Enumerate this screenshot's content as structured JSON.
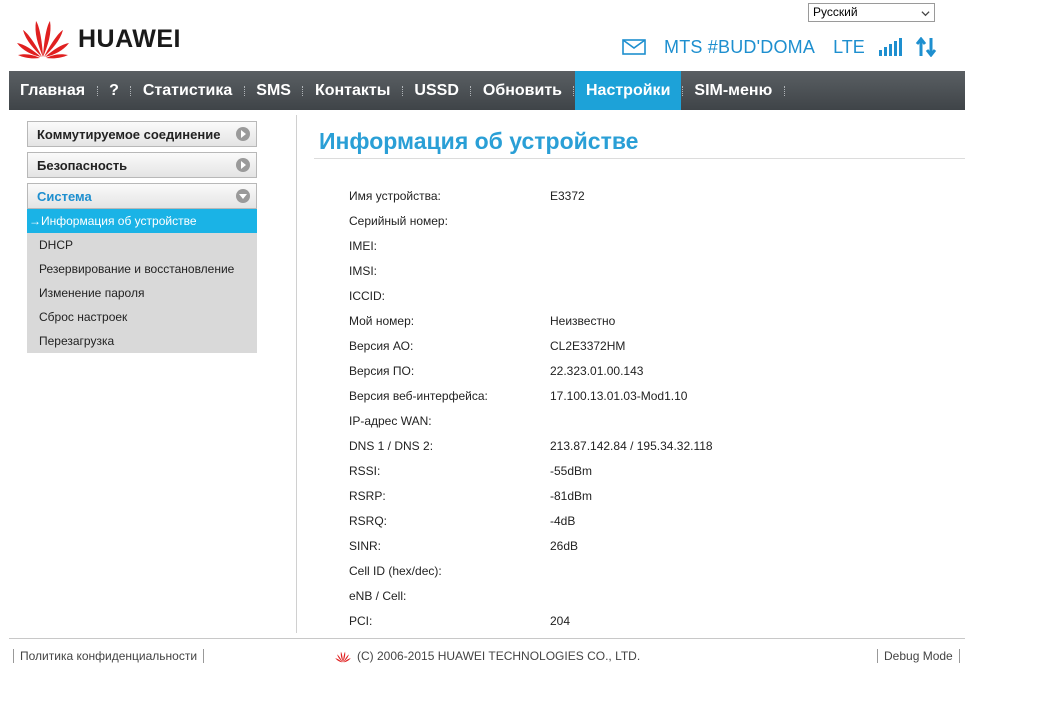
{
  "language": {
    "selected": "Русский"
  },
  "brand": {
    "name": "HUAWEI",
    "color": "#e02020"
  },
  "status": {
    "operator": "MTS #BUD'DOMA",
    "network": "LTE",
    "icons": [
      "mail-icon",
      "signal-icon",
      "data-arrows-icon"
    ],
    "accent_color": "#1e8fcf"
  },
  "nav": {
    "items": [
      "Главная",
      "?",
      "Статистика",
      "SMS",
      "Контакты",
      "USSD",
      "Обновить",
      "Настройки",
      "SIM-меню"
    ],
    "active": "Настройки",
    "active_color": "#1da2d8"
  },
  "sidebar": {
    "groups": [
      {
        "label": "Коммутируемое соединение"
      },
      {
        "label": "Безопасность"
      },
      {
        "label": "Система"
      }
    ],
    "system_items": [
      "→Информация об устройстве",
      "DHCP",
      "Резервирование и восстановление",
      "Изменение пароля",
      "Сброс настроек",
      "Перезагрузка"
    ]
  },
  "page": {
    "title": "Информация об устройстве",
    "rows": [
      {
        "label": "Имя устройства:",
        "value": "E3372"
      },
      {
        "label": "Серийный номер:",
        "value": ""
      },
      {
        "label": "IMEI:",
        "value": ""
      },
      {
        "label": "IMSI:",
        "value": ""
      },
      {
        "label": "ICCID:",
        "value": ""
      },
      {
        "label": "Мой номер:",
        "value": "Неизвестно"
      },
      {
        "label": "Версия АО:",
        "value": "CL2E3372HM"
      },
      {
        "label": "Версия ПО:",
        "value": "22.323.01.00.143"
      },
      {
        "label": "Версия веб-интерфейса:",
        "value": "17.100.13.01.03-Mod1.10"
      },
      {
        "label": "IP-адрес WAN:",
        "value": ""
      },
      {
        "label": "DNS 1 / DNS 2:",
        "value": "213.87.142.84 / 195.34.32.118"
      },
      {
        "label": "RSSI:",
        "value": "-55dBm"
      },
      {
        "label": "RSRP:",
        "value": "-81dBm"
      },
      {
        "label": "RSRQ:",
        "value": "-4dB"
      },
      {
        "label": "SINR:",
        "value": "26dB"
      },
      {
        "label": "Cell ID (hex/dec):",
        "value": ""
      },
      {
        "label": "eNB / Cell:",
        "value": ""
      },
      {
        "label": "PCI:",
        "value": "204"
      }
    ]
  },
  "footer": {
    "privacy": "Политика конфиденциальности",
    "copyright": "(C) 2006-2015 HUAWEI TECHNOLOGIES CO., LTD.",
    "debug": "Debug Mode"
  }
}
